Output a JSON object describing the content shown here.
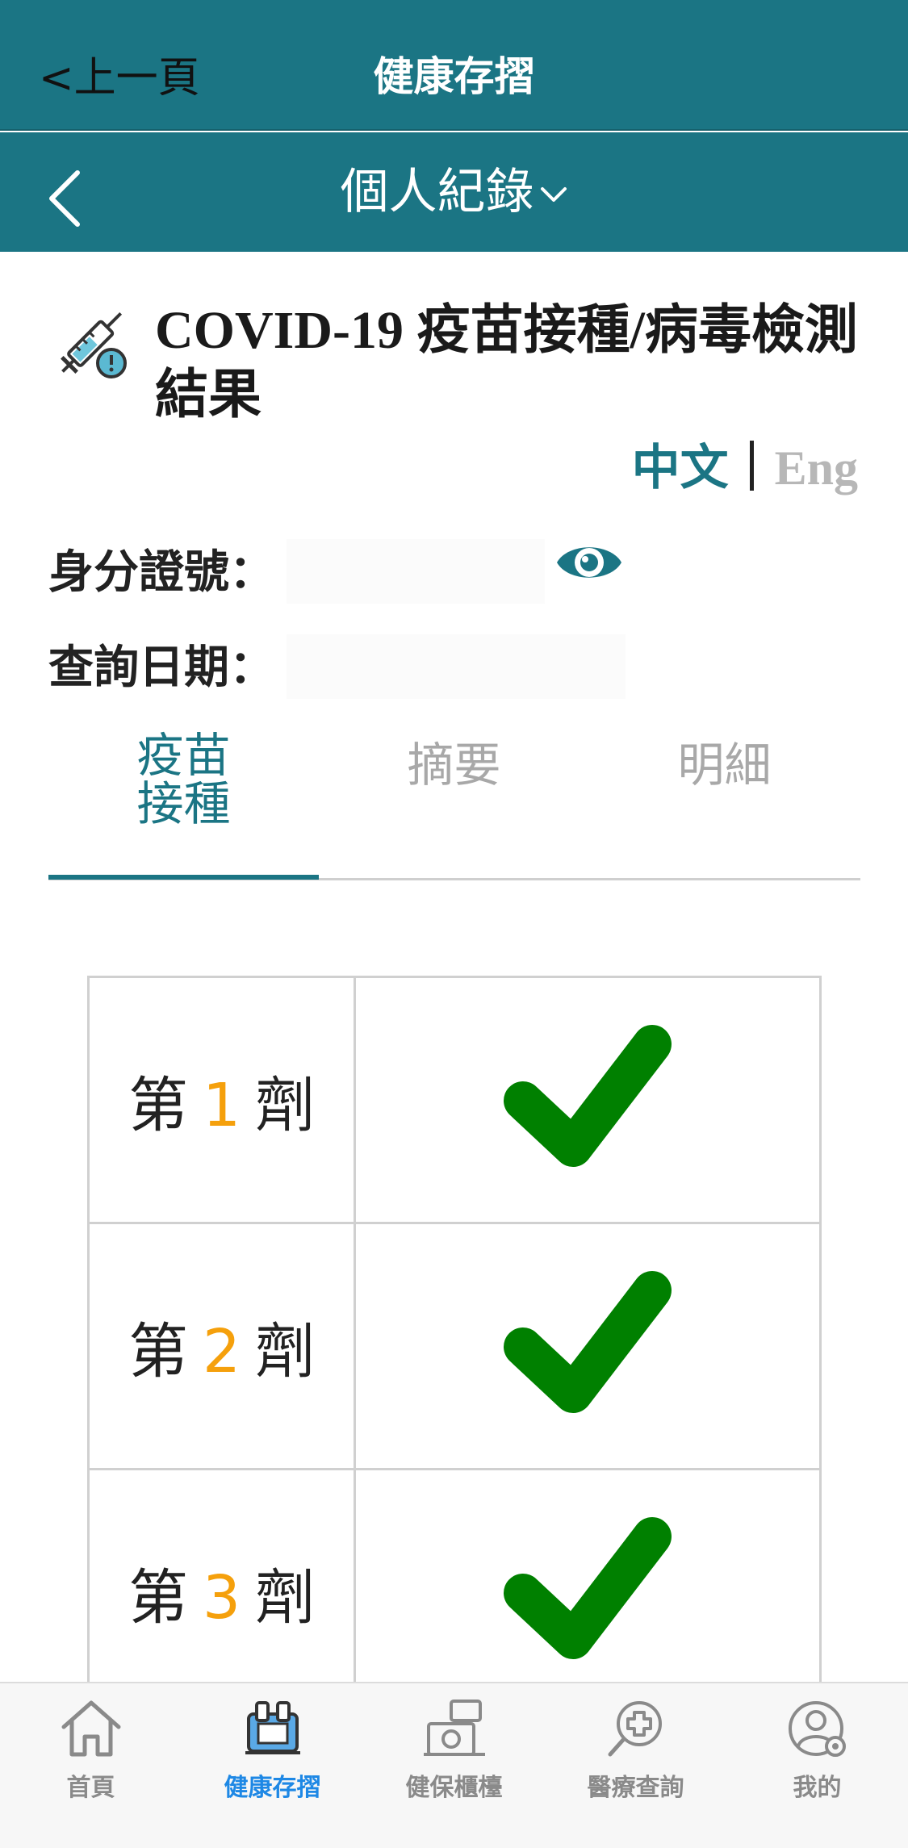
{
  "header": {
    "back_label": "<上一頁",
    "title": "健康存摺"
  },
  "subheader": {
    "title": "個人紀錄"
  },
  "section": {
    "title": "COVID-19 疫苗接種/病毒檢測結果"
  },
  "language": {
    "zh": "中文",
    "en": "Eng"
  },
  "fields": {
    "id_label": "身分證號：",
    "id_value": "",
    "date_label": "查詢日期：",
    "date_value": ""
  },
  "tabs": [
    {
      "label": "疫苗\n接種",
      "active": true
    },
    {
      "label": "摘要",
      "active": false
    },
    {
      "label": "明細",
      "active": false
    }
  ],
  "doses": [
    {
      "prefix": "第",
      "number": "1",
      "suffix": "劑",
      "completed": true
    },
    {
      "prefix": "第",
      "number": "2",
      "suffix": "劑",
      "completed": true
    },
    {
      "prefix": "第",
      "number": "3",
      "suffix": "劑",
      "completed": true
    }
  ],
  "nav": [
    {
      "label": "首頁",
      "icon": "home-icon",
      "active": false
    },
    {
      "label": "健康存摺",
      "icon": "health-passbook-icon",
      "active": true
    },
    {
      "label": "健保櫃檯",
      "icon": "insurance-counter-icon",
      "active": false
    },
    {
      "label": "醫療查詢",
      "icon": "medical-search-icon",
      "active": false
    },
    {
      "label": "我的",
      "icon": "user-settings-icon",
      "active": false
    }
  ],
  "colors": {
    "primary": "#1b7584",
    "check": "#008000",
    "dose_number": "#f5a00c",
    "nav_active": "#1e88e5",
    "nav_inactive": "#8a8a8a"
  }
}
